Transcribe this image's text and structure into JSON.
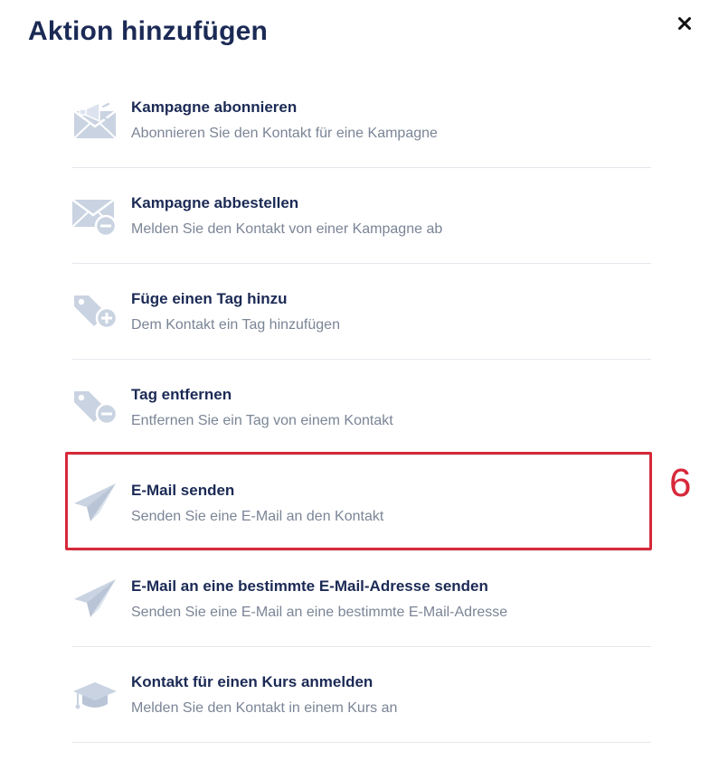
{
  "dialog": {
    "title": "Aktion hinzufügen",
    "close_icon": "close-icon"
  },
  "actions": [
    {
      "icon": "campaign-subscribe-icon",
      "title": "Kampagne abonnieren",
      "description": "Abonnieren Sie den Kontakt für eine Kampagne"
    },
    {
      "icon": "campaign-unsubscribe-icon",
      "title": "Kampagne abbestellen",
      "description": "Melden Sie den Kontakt von einer Kampagne ab"
    },
    {
      "icon": "tag-add-icon",
      "title": "Füge einen Tag hinzu",
      "description": "Dem Kontakt ein Tag hinzufügen"
    },
    {
      "icon": "tag-remove-icon",
      "title": "Tag entfernen",
      "description": "Entfernen Sie ein Tag von einem Kontakt"
    },
    {
      "icon": "paper-plane-icon",
      "title": "E-Mail senden",
      "description": "Senden Sie eine E-Mail an den Kontakt"
    },
    {
      "icon": "paper-plane-icon",
      "title": "E-Mail an eine bestimmte E-Mail-Adresse senden",
      "description": "Senden Sie eine E-Mail an eine bestimmte E-Mail-Adresse"
    },
    {
      "icon": "graduation-cap-icon",
      "title": "Kontakt für einen Kurs anmelden",
      "description": "Melden Sie den Kontakt in einem Kurs an"
    }
  ],
  "annotation": {
    "step_number": "6",
    "highlighted_item": "E-Mail senden",
    "color": "#d7283a"
  },
  "colors": {
    "title": "#1b2a55",
    "description": "#7b8596",
    "icon": "#c9d3e1",
    "divider": "#e4e7ed"
  }
}
